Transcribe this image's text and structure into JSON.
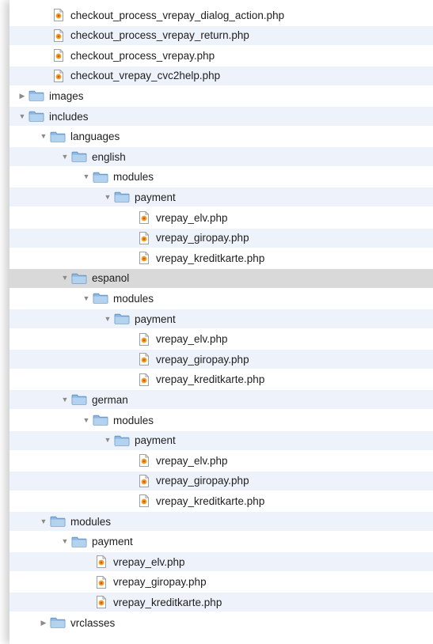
{
  "tree": [
    {
      "label": "checkout_process_vrepay_dialog_action.php",
      "type": "file",
      "depth": 1
    },
    {
      "label": "checkout_process_vrepay_return.php",
      "type": "file",
      "depth": 1
    },
    {
      "label": "checkout_process_vrepay.php",
      "type": "file",
      "depth": 1
    },
    {
      "label": "checkout_vrepay_cvc2help.php",
      "type": "file",
      "depth": 1
    },
    {
      "label": "images",
      "type": "folder",
      "depth": 0,
      "expanded": false
    },
    {
      "label": "includes",
      "type": "folder",
      "depth": 0,
      "expanded": true
    },
    {
      "label": "languages",
      "type": "folder",
      "depth": 1,
      "expanded": true
    },
    {
      "label": "english",
      "type": "folder",
      "depth": 2,
      "expanded": true
    },
    {
      "label": "modules",
      "type": "folder",
      "depth": 3,
      "expanded": true
    },
    {
      "label": "payment",
      "type": "folder",
      "depth": 4,
      "expanded": true
    },
    {
      "label": "vrepay_elv.php",
      "type": "file",
      "depth": 5
    },
    {
      "label": "vrepay_giropay.php",
      "type": "file",
      "depth": 5
    },
    {
      "label": "vrepay_kreditkarte.php",
      "type": "file",
      "depth": 5
    },
    {
      "label": "espanol",
      "type": "folder",
      "depth": 2,
      "expanded": true,
      "selected": true
    },
    {
      "label": "modules",
      "type": "folder",
      "depth": 3,
      "expanded": true
    },
    {
      "label": "payment",
      "type": "folder",
      "depth": 4,
      "expanded": true
    },
    {
      "label": "vrepay_elv.php",
      "type": "file",
      "depth": 5
    },
    {
      "label": "vrepay_giropay.php",
      "type": "file",
      "depth": 5
    },
    {
      "label": "vrepay_kreditkarte.php",
      "type": "file",
      "depth": 5
    },
    {
      "label": "german",
      "type": "folder",
      "depth": 2,
      "expanded": true
    },
    {
      "label": "modules",
      "type": "folder",
      "depth": 3,
      "expanded": true
    },
    {
      "label": "payment",
      "type": "folder",
      "depth": 4,
      "expanded": true
    },
    {
      "label": "vrepay_elv.php",
      "type": "file",
      "depth": 5
    },
    {
      "label": "vrepay_giropay.php",
      "type": "file",
      "depth": 5
    },
    {
      "label": "vrepay_kreditkarte.php",
      "type": "file",
      "depth": 5
    },
    {
      "label": "modules",
      "type": "folder",
      "depth": 1,
      "expanded": true
    },
    {
      "label": "payment",
      "type": "folder",
      "depth": 2,
      "expanded": true
    },
    {
      "label": "vrepay_elv.php",
      "type": "file",
      "depth": 3
    },
    {
      "label": "vrepay_giropay.php",
      "type": "file",
      "depth": 3
    },
    {
      "label": "vrepay_kreditkarte.php",
      "type": "file",
      "depth": 3
    },
    {
      "label": "vrclasses",
      "type": "folder",
      "depth": 1,
      "expanded": false
    }
  ],
  "icons": {
    "file": "php-file-icon",
    "folder": "folder-icon",
    "expanded": "disclosure-triangle-down-icon",
    "collapsed": "disclosure-triangle-right-icon"
  },
  "colors": {
    "row_alternate": "#eef3fb",
    "row_selected": "#d9d9d9",
    "folder_blue": "#8cb9e2",
    "php_orange": "#f0a020"
  }
}
